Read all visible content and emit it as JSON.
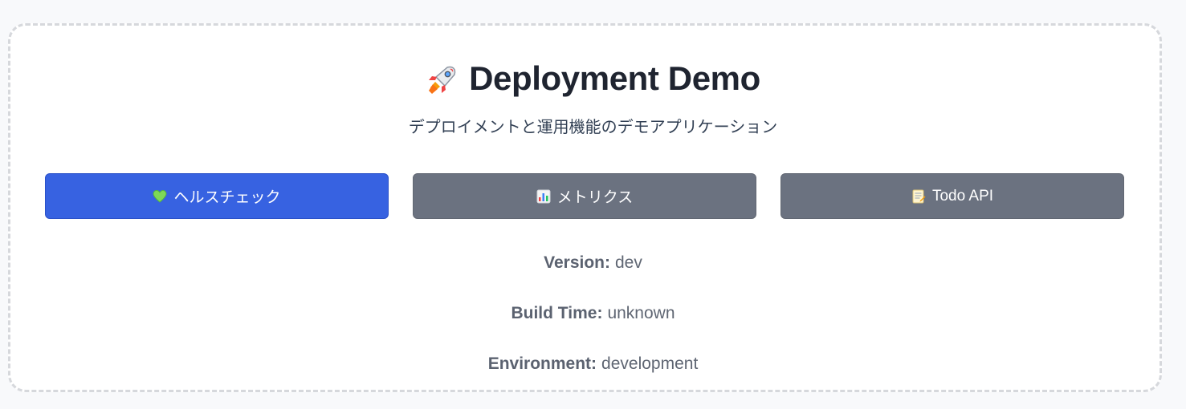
{
  "header": {
    "title": "Deployment Demo",
    "subtitle": "デプロイメントと運用機能のデモアプリケーション"
  },
  "actions": [
    {
      "label": "ヘルスチェック",
      "icon": "green-heart-icon",
      "color": "#3762e1"
    },
    {
      "label": "メトリクス",
      "icon": "bar-chart-icon",
      "color": "#6b7280"
    },
    {
      "label": "Todo API",
      "icon": "memo-icon",
      "color": "#6b7280"
    }
  ],
  "info": {
    "version_label": "Version:",
    "version_value": "dev",
    "build_label": "Build Time:",
    "build_value": "unknown",
    "env_label": "Environment:",
    "env_value": "development"
  }
}
